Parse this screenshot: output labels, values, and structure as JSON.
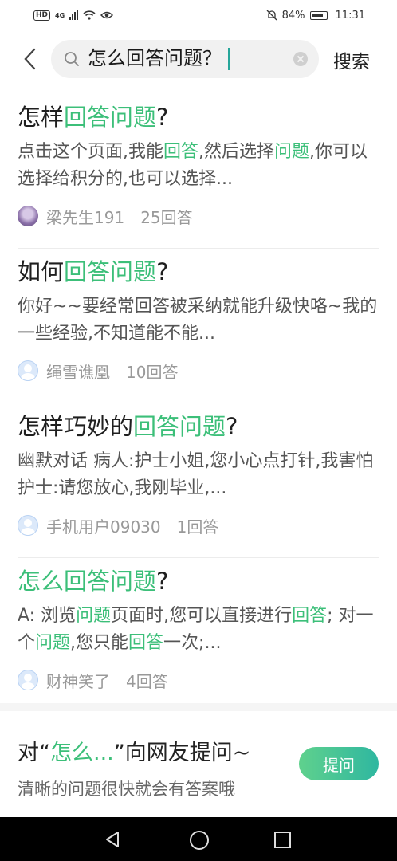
{
  "status": {
    "battery": "84%",
    "time": "11:31",
    "network": "4G",
    "hd": "HD"
  },
  "header": {
    "query": "怎么回答问题？",
    "search_label": "搜索"
  },
  "results": [
    {
      "title": [
        {
          "text": "怎样",
          "hl": false
        },
        {
          "text": "回答问题",
          "hl": true
        },
        {
          "text": "?",
          "hl": false
        }
      ],
      "snippet": [
        {
          "text": "点击这个页面,我能",
          "hl": false
        },
        {
          "text": "回答",
          "hl": true
        },
        {
          "text": ",然后选择",
          "hl": false
        },
        {
          "text": "问题",
          "hl": true
        },
        {
          "text": ",你可以选择给积分的,也可以选择...",
          "hl": false
        }
      ],
      "author": "梁先生191",
      "answers": "25回答",
      "avatar": "photo"
    },
    {
      "title": [
        {
          "text": "如何",
          "hl": false
        },
        {
          "text": "回答问题",
          "hl": true
        },
        {
          "text": "?",
          "hl": false
        }
      ],
      "snippet": [
        {
          "text": "你好~~要经常回答被采纳就能升级快咯~我的一些经验,不知道能不能...",
          "hl": false
        }
      ],
      "author": "绳雪谯凰",
      "answers": "10回答",
      "avatar": "default"
    },
    {
      "title": [
        {
          "text": "怎样巧妙的",
          "hl": false
        },
        {
          "text": "回答问题",
          "hl": true
        },
        {
          "text": "?",
          "hl": false
        }
      ],
      "snippet": [
        {
          "text": "幽默对话 病人:护士小姐,您小心点打针,我害怕 护士:请您放心,我刚毕业,...",
          "hl": false
        }
      ],
      "author": "手机用户09030",
      "answers": "1回答",
      "avatar": "default"
    },
    {
      "title": [
        {
          "text": "怎么回答问题",
          "hl": true
        },
        {
          "text": "?",
          "hl": false
        }
      ],
      "snippet": [
        {
          "text": "A: 浏览",
          "hl": false
        },
        {
          "text": "问题",
          "hl": true
        },
        {
          "text": "页面时,您可以直接进行",
          "hl": false
        },
        {
          "text": "回答",
          "hl": true
        },
        {
          "text": "; 对一个",
          "hl": false
        },
        {
          "text": "问题",
          "hl": true
        },
        {
          "text": ",您只能",
          "hl": false
        },
        {
          "text": "回答",
          "hl": true
        },
        {
          "text": "一次;...",
          "hl": false
        }
      ],
      "author": "财神笑了",
      "answers": "4回答",
      "avatar": "default"
    }
  ],
  "ask": {
    "prefix": "对“",
    "keyword": "怎么...",
    "suffix": "”向网友提问~",
    "subtitle": "清晰的问题很快就会有答案哦",
    "button_label": "提问"
  },
  "colors": {
    "highlight": "#3cbf79",
    "button_start": "#5fd18d",
    "button_end": "#2fb7a0"
  }
}
